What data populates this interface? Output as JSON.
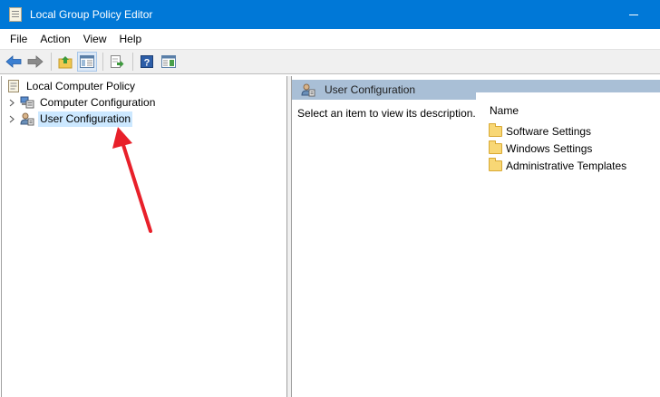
{
  "window": {
    "title": "Local Group Policy Editor",
    "title_bar_color": "#0078d7"
  },
  "menu": [
    "File",
    "Action",
    "View",
    "Help"
  ],
  "toolbar": {
    "buttons": [
      "back-icon",
      "forward-icon",
      "up-folder-icon",
      "show-hide-tree-icon",
      "export-list-icon",
      "help-icon",
      "console-view-icon"
    ]
  },
  "tree": {
    "root": "Local Computer Policy",
    "items": [
      {
        "label": "Computer Configuration",
        "icon": "computer-icon"
      },
      {
        "label": "User Configuration",
        "icon": "user-icon",
        "selected": true
      }
    ]
  },
  "details": {
    "header": "User Configuration",
    "description": "Select an item to view its description.",
    "column_header": "Name",
    "items": [
      "Software Settings",
      "Windows Settings",
      "Administrative Templates"
    ]
  },
  "annotation": {
    "arrow_color": "#e8202a"
  }
}
